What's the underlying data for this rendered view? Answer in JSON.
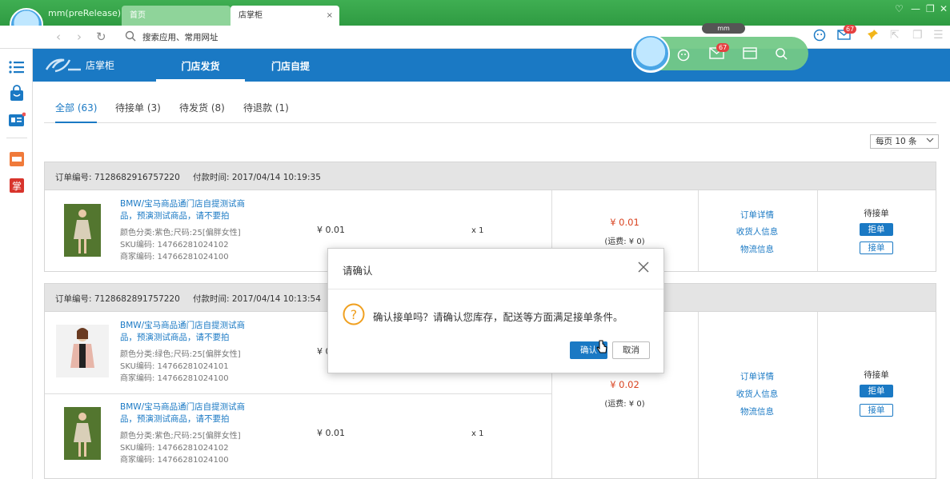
{
  "window": {
    "app_title": "mm(preRelease)",
    "tabs": [
      {
        "label": "首页"
      },
      {
        "label": "店掌柜"
      }
    ],
    "tab_close": "×",
    "user_name": "mm",
    "mail_count": "67",
    "address_placeholder": "搜索应用、常用网址"
  },
  "header": {
    "logo_text": "店掌柜",
    "tabs": [
      {
        "label": "门店发货"
      },
      {
        "label": "门店自提"
      }
    ],
    "toolbar_mail_count": "67"
  },
  "subtabs": [
    {
      "label": "全部 (63)"
    },
    {
      "label": "待接单 (3)"
    },
    {
      "label": "待发货 (8)"
    },
    {
      "label": "待退款 (1)"
    }
  ],
  "per_page": "每页 10 条",
  "orders": [
    {
      "order_no": "订单编号: 7128682916757220",
      "paid_time": "付款时间: 2017/04/14 10:19:35",
      "items": [
        {
          "title_l1": "BMW/宝马商品通门店自提测试商",
          "title_l2": "品，预演测试商品，请不要拍",
          "attr": "颜色分类:紫色;尺码:25[偏胖女性]",
          "sku": "SKU编码: 14766281024102",
          "merchant": "商家编码: 14766281024100",
          "price": "¥ 0.01",
          "qty": "x 1"
        }
      ],
      "total": "¥ 0.01",
      "shipping": "(运费: ¥ 0)",
      "links": [
        "订单详情",
        "收货人信息",
        "物流信息"
      ],
      "status": "待接单",
      "reject": "拒单",
      "accept": "接单"
    },
    {
      "order_no": "订单编号: 7128682891757220",
      "paid_time": "付款时间: 2017/04/14 10:13:54",
      "items": [
        {
          "title_l1": "BMW/宝马商品通门店自提测试商",
          "title_l2": "品，预演测试商品，请不要拍",
          "attr": "颜色分类:绿色;尺码:25[偏胖女性]",
          "sku": "SKU编码: 14766281024101",
          "merchant": "商家编码: 14766281024100",
          "price": "¥ 0",
          "qty": ""
        },
        {
          "title_l1": "BMW/宝马商品通门店自提测试商",
          "title_l2": "品，预演测试商品，请不要拍",
          "attr": "颜色分类:紫色;尺码:25[偏胖女性]",
          "sku": "SKU编码: 14766281024102",
          "merchant": "商家编码: 14766281024100",
          "price": "¥ 0.01",
          "qty": "x 1"
        }
      ],
      "total": "¥ 0.02",
      "shipping": "(运费: ¥ 0)",
      "links": [
        "订单详情",
        "收货人信息",
        "物流信息"
      ],
      "status": "待接单",
      "reject": "拒单",
      "accept": "接单"
    }
  ],
  "modal": {
    "title": "请确认",
    "message": "确认接单吗？请确认您库存，配送等方面满足接单条件。",
    "ok": "确认",
    "cancel": "取消"
  },
  "colors": {
    "brand_blue": "#1a79c4",
    "titlebar_green": "#3fae52",
    "price_red": "#d9421f",
    "warning_orange": "#f0a020"
  },
  "icons": [
    "menu-icon",
    "shopping-bag-icon",
    "id-card-icon",
    "store-icon",
    "palm-icon",
    "search-icon",
    "mail-icon",
    "pin-icon",
    "close-icon",
    "question-icon"
  ]
}
